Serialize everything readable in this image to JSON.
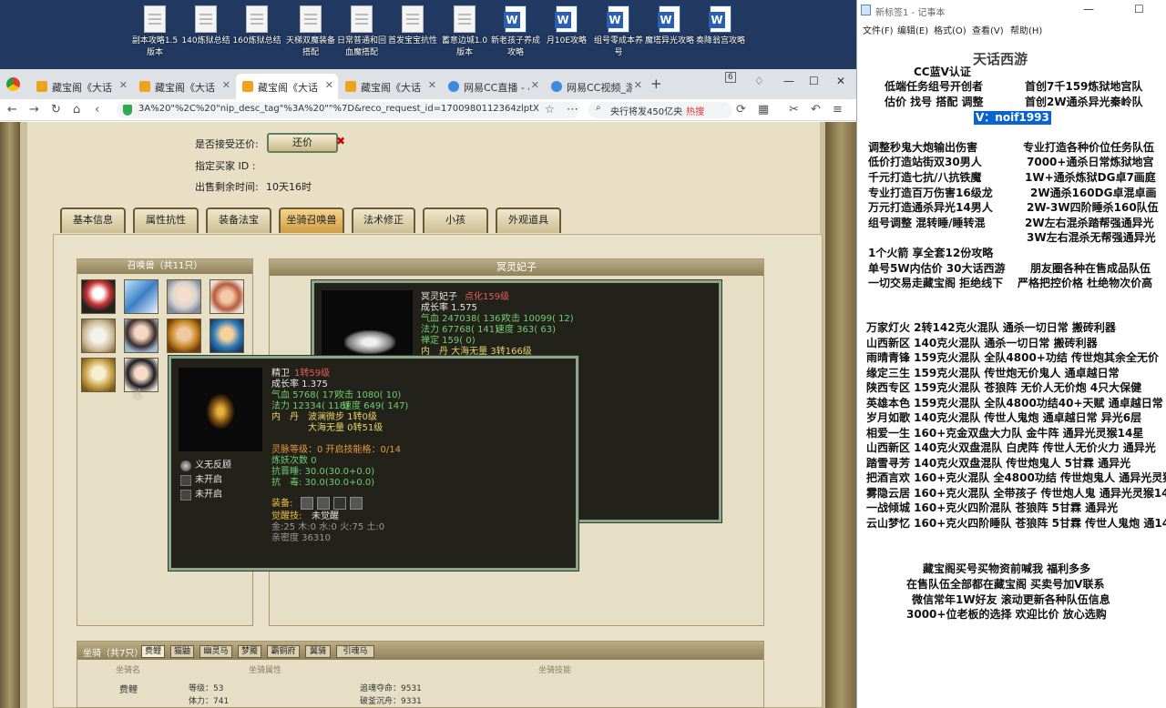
{
  "desktop": {
    "icons": [
      {
        "label": "副本攻略1.5版本",
        "type": "file"
      },
      {
        "label": "140炼狱总结",
        "type": "file"
      },
      {
        "label": "160炼狱总结",
        "type": "file"
      },
      {
        "label": "天梯双魔装备搭配",
        "type": "file"
      },
      {
        "label": "日常普通和回血魔搭配",
        "type": "file"
      },
      {
        "label": "首发宝宝抗性",
        "type": "file"
      },
      {
        "label": "蓄意边城1.0版本",
        "type": "file"
      },
      {
        "label": "新老孩子养成攻略",
        "type": "word"
      },
      {
        "label": "月10E攻略",
        "type": "word"
      },
      {
        "label": "组号零成本养号",
        "type": "word"
      },
      {
        "label": "魔塔异光攻略",
        "type": "word"
      },
      {
        "label": "奏降翁宫攻略",
        "type": "word"
      }
    ]
  },
  "browser": {
    "tabs": [
      {
        "label": "藏宝阁《大话",
        "icon": "treasure-icon"
      },
      {
        "label": "藏宝阁《大话",
        "icon": "treasure-icon"
      },
      {
        "label": "藏宝阁《大话",
        "icon": "treasure-icon",
        "active": true
      },
      {
        "label": "藏宝阁《大话",
        "icon": "treasure-icon"
      },
      {
        "label": "网易CC直播 - 小",
        "icon": "live-icon"
      },
      {
        "label": "网易CC视频_游",
        "icon": "live-icon"
      }
    ],
    "tab_count": "6",
    "url": "3A%20\"%2C%20\"nip_desc_tag\"%3A%20\"\"%7D&reco_request_id=1700980112364zlptX",
    "search_text": "央行将发450亿央",
    "hot_label": "热搜"
  },
  "game": {
    "haggle_label": "是否接受还价:",
    "haggle_button": "还价",
    "buyer_id_label": "指定买家 ID :",
    "time_left_label": "出售剩余时间:",
    "time_left_value": "10天16时",
    "tabs": [
      "基本信息",
      "属性抗性",
      "装备法宝",
      "坐骑召唤兽",
      "法术修正",
      "小孩",
      "外观道具"
    ],
    "active_tab": "坐骑召唤兽",
    "summon_header": "召唤兽（共11只）",
    "detail_header": "冥灵妃子",
    "pet_main": {
      "name": "冥灵妃子",
      "level": "点化159级",
      "growth": "成长率 1.575",
      "hp": "气血 247038( 136)",
      "atk": "攻击 10099( 12)",
      "mp": "法力 67768( 141)",
      "spd": "速度 363( 63)",
      "zen": "禅定 159( 0)",
      "dan": "内　丹 大海无量 3转166级"
    },
    "pet_tip": {
      "name": "精卫",
      "level": "1转59级",
      "growth": "成长率 1.375",
      "hp": "气血 5768( 17)",
      "atk": "攻击 1080( 10)",
      "mp": "法力 12334( 118)",
      "spd": "速度 649( 147)",
      "dan1_label": "内　丹",
      "dan1": "波澜微步 1转0级",
      "dan2": "大海无量 0转51级",
      "skills": [
        "义无反顾",
        "未开启",
        "未开启"
      ],
      "spirit": "灵脉等级：0 开启技能格：0/14",
      "refine": "炼妖次数 0",
      "resist1": "抗晋睡: 30.0(30.0+0.0)",
      "resist2": "抗　毒: 30.0(30.0+0.0)",
      "equip_label": "装备:",
      "awaken_label": "觉醒技:",
      "awaken_value": "未觉醒",
      "elements": "金:25 木:0 水:0 火:75 土:0",
      "intimacy": "亲密度 36310"
    },
    "mount": {
      "title": "坐骑（共7只）",
      "tabs": [
        "费鲤",
        "猫鼬",
        "幽灵马",
        "梦魇",
        "霸铜府",
        "翼骑",
        "引魂马"
      ],
      "headers": [
        "坐骑名",
        "坐骑属性",
        "坐骑技能"
      ],
      "name": "费鲤",
      "level": "等级：53",
      "stamina": "体力：741",
      "skill1": "追魂夺命：9531",
      "skill2": "破釜沉舟：9331"
    }
  },
  "notepad": {
    "title": "新标签1 - 记事本",
    "menu": [
      "文件(F)",
      "编辑(E)",
      "格式(O)",
      "查看(V)",
      "帮助(H)"
    ],
    "lines": [
      "CC蓝V认证",
      "低端任务组号开创者",
      "首创7千159炼狱地宫队",
      "估价 找号 搭配 调整",
      "首创2W通杀异光秦岭队",
      "V：noif1993",
      "调整秒鬼大炮输出伤害",
      "专业打造各种价位任务队伍",
      "低价打造站街双30男人",
      "7000+通杀日常炼狱地宫",
      "千元打造七抗/八抗铁魔",
      "1W+通杀炼狱DG卓7画庭",
      "专业打造百万伤害16级龙",
      "2W通杀160DG卓混卓画",
      "万元打造通杀异光14男人",
      "2W-3W四阶睡杀160队伍",
      "组号调整 混转睡/睡转混",
      "2W左右混杀踏帮强通异光",
      "3W左右混杀无帮强通异光",
      "1个火箭 享全套12份攻略",
      "单号5W内估价 30大话西游",
      "朋友圈各种在售成品队伍",
      "一切交易走藏宝阁 拒绝线下",
      "严格把控价格 杜绝物次价高",
      "万家灯火 2转142克火混队 通杀一切日常 搬砖利器",
      "山西新区 140克火混队 通杀一切日常 搬砖利器",
      "雨晴青锋 159克火混队 全队4800+功结 传世炮其余全无价",
      "缘定三生 159克火混队 传世炮无价鬼人 通卓越日常",
      "陕西专区 159克火混队 苍狼阵 无价人无价炮 4只大保健",
      "英雄本色 159克火混队 全队4800功结40+天赋 通卓越日常",
      "岁月如歌 140克火混队 传世人鬼炮 通卓越日常 异光6层",
      "相爱一生 160+克金双盘大力队 金牛阵 通异光灵猴14星",
      "山西新区 140克火双盘混队 白虎阵 传世人无价火力 通异光",
      "踏雪寻芳 140克火双盘混队 传世炮鬼人 5甘霖 通异光",
      "把酒言欢 160+克火混队 全4800功结 传世炮鬼人 通异光灵猴",
      "雾隐云居 160+克火混队 全带孩子 传世炮人鬼 通异光灵猴14",
      "一战倾城 160+克火四阶混队 苍狼阵 5甘霖 通异光",
      "云山梦忆 160+克火四阶睡队 苍狼阵 5甘霖 传世人鬼炮 通14",
      "藏宝阁买号买物资前喊我 福利多多",
      "在售队伍全部都在藏宝阁 买卖号加V联系",
      "微信常年1W好友 滚动更新各种队伍信息",
      "3000+位老板的选择 欢迎比价 放心选购"
    ],
    "watermark": "天话西游"
  },
  "colors": {
    "notepad_selection": "#0a64d0",
    "tooltip_border": "#8ba68c",
    "desktop_bg": "#223a63"
  }
}
